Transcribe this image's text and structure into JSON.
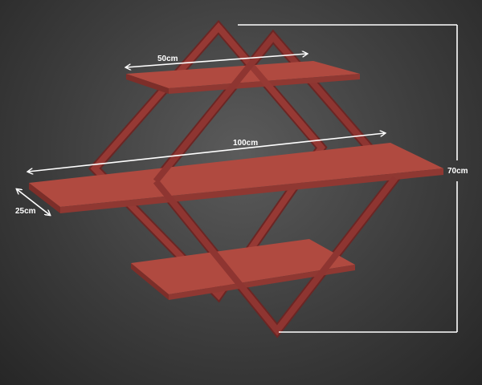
{
  "dimensions": {
    "top_shelf_width": "50cm",
    "middle_shelf_width": "100cm",
    "depth": "25cm",
    "overall_height": "70cm"
  },
  "colors": {
    "frame": "#8e3531",
    "frame_dark": "#6b2624",
    "shelf_top": "#b04a40",
    "shelf_edge": "#7d2e29",
    "dimension_lines": "#ffffff",
    "background": "#3d3d3d"
  }
}
